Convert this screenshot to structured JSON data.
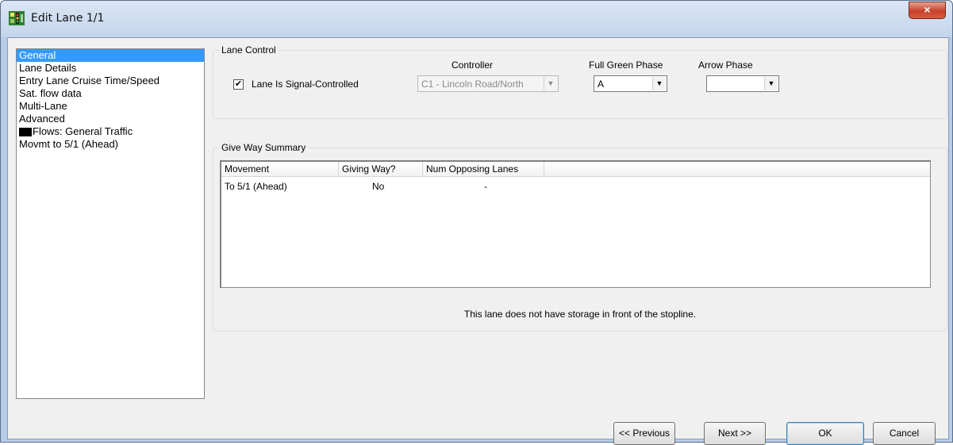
{
  "window": {
    "title": "Edit Lane 1/1",
    "close_glyph": "×"
  },
  "nav": {
    "items": [
      {
        "label": "General",
        "selected": true
      },
      {
        "label": "Lane Details"
      },
      {
        "label": "Entry Lane Cruise Time/Speed"
      },
      {
        "label": "Sat. flow data"
      },
      {
        "label": "Multi-Lane"
      },
      {
        "label": "Advanced"
      },
      {
        "label": "Flows: General Traffic",
        "swatch": "#000000"
      },
      {
        "label": "Movmt to 5/1 (Ahead)"
      }
    ]
  },
  "lane_control": {
    "legend": "Lane Control",
    "signal_checkbox": {
      "label": "Lane Is Signal-Controlled",
      "checked": true,
      "mark": "✔"
    },
    "controller": {
      "label": "Controller",
      "value": "C1 - Lincoln Road/North",
      "disabled": true
    },
    "full_green_phase": {
      "label": "Full Green Phase",
      "value": "A"
    },
    "arrow_phase": {
      "label": "Arrow Phase",
      "value": ""
    }
  },
  "give_way": {
    "legend": "Give Way Summary",
    "columns": [
      "Movement",
      "Giving Way?",
      "Num Opposing Lanes"
    ],
    "rows": [
      {
        "movement": "To 5/1 (Ahead)",
        "giving_way": "No",
        "num_opposing": "-"
      }
    ],
    "note": "This lane does not have storage in front of the stopline."
  },
  "buttons": {
    "previous": "<< Previous",
    "next": "Next >>",
    "ok": "OK",
    "cancel": "Cancel"
  },
  "icons": {
    "dropdown": "▼"
  },
  "colors": {
    "selection": "#3399ff",
    "close_button": "#c6412a"
  }
}
